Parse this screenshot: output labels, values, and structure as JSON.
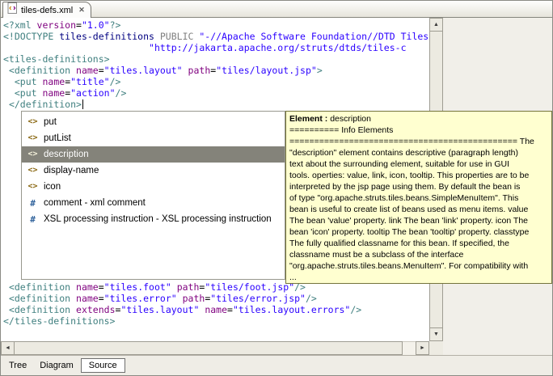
{
  "colors": {
    "syntax_tag": "#3F7F7F",
    "syntax_attr": "#7F007F",
    "syntax_value": "#2A00FF",
    "syntax_doctype_name": "#000080",
    "syntax_keyword": "#808080",
    "selection_bg": "#84837A",
    "tooltip_bg": "#FFFFD0",
    "tooltip_border": "#74743C",
    "element_icon_color": "#8B6914",
    "comment_icon_color": "#31639C"
  },
  "icons": {
    "element": "<>",
    "comment": "#",
    "close": "✕",
    "up": "▲",
    "down": "▼",
    "left": "◄",
    "right": "►"
  },
  "tab": {
    "title": "tiles-defs.xml"
  },
  "editor": {
    "top_lines": [
      [
        [
          "tag",
          "<?xml "
        ],
        [
          "attr",
          "version"
        ],
        [
          "text",
          "="
        ],
        [
          "val",
          "\"1.0\""
        ],
        [
          "tag",
          "?>"
        ]
      ],
      [
        [
          "tag",
          "<!DOCTYPE "
        ],
        [
          "dname",
          "tiles-definitions "
        ],
        [
          "kw",
          "PUBLIC "
        ],
        [
          "val",
          "\"-//Apache Software Foundation//DTD Tiles Conf"
        ]
      ],
      [
        [
          "text",
          "                          "
        ],
        [
          "val",
          "\"http://jakarta.apache.org/struts/dtds/tiles-c"
        ]
      ],
      [
        [
          "tag",
          "<tiles-definitions>"
        ]
      ],
      [
        [
          "text",
          " "
        ],
        [
          "tag",
          "<definition "
        ],
        [
          "attr",
          "name"
        ],
        [
          "text",
          "="
        ],
        [
          "val",
          "\"tiles.layout\""
        ],
        [
          "text",
          " "
        ],
        [
          "attr",
          "path"
        ],
        [
          "text",
          "="
        ],
        [
          "val",
          "\"tiles/layout.jsp\""
        ],
        [
          "tag",
          ">"
        ]
      ],
      [
        [
          "text",
          "  "
        ],
        [
          "tag",
          "<put "
        ],
        [
          "attr",
          "name"
        ],
        [
          "text",
          "="
        ],
        [
          "val",
          "\"title\""
        ],
        [
          "tag",
          "/>"
        ]
      ],
      [
        [
          "text",
          "  "
        ],
        [
          "tag",
          "<put "
        ],
        [
          "attr",
          "name"
        ],
        [
          "text",
          "="
        ],
        [
          "val",
          "\"action\""
        ],
        [
          "tag",
          "/>"
        ]
      ],
      [
        [
          "text",
          " "
        ],
        [
          "tag",
          "</definition>"
        ],
        [
          "cursor",
          ""
        ]
      ]
    ],
    "bottom_lines": [
      [
        [
          "text",
          " "
        ],
        [
          "tag",
          "<definition "
        ],
        [
          "attr",
          "name"
        ],
        [
          "text",
          "="
        ],
        [
          "val",
          "\"tiles.foot\""
        ],
        [
          "text",
          " "
        ],
        [
          "attr",
          "path"
        ],
        [
          "text",
          "="
        ],
        [
          "val",
          "\"tiles/foot.jsp\""
        ],
        [
          "tag",
          "/>"
        ]
      ],
      [
        [
          "text",
          " "
        ],
        [
          "tag",
          "<definition "
        ],
        [
          "attr",
          "name"
        ],
        [
          "text",
          "="
        ],
        [
          "val",
          "\"tiles.error\""
        ],
        [
          "text",
          " "
        ],
        [
          "attr",
          "path"
        ],
        [
          "text",
          "="
        ],
        [
          "val",
          "\"tiles/error.jsp\""
        ],
        [
          "tag",
          "/>"
        ]
      ],
      [
        [
          "text",
          " "
        ],
        [
          "tag",
          "<definition "
        ],
        [
          "attr",
          "extends"
        ],
        [
          "text",
          "="
        ],
        [
          "val",
          "\"tiles.layout\""
        ],
        [
          "text",
          " "
        ],
        [
          "attr",
          "name"
        ],
        [
          "text",
          "="
        ],
        [
          "val",
          "\"tiles.layout.errors\""
        ],
        [
          "tag",
          "/>"
        ]
      ],
      [
        [
          "tag",
          "</tiles-definitions>"
        ]
      ]
    ]
  },
  "completion": {
    "items": [
      {
        "icon": "element",
        "label": "put",
        "selected": false
      },
      {
        "icon": "element",
        "label": "putList",
        "selected": false
      },
      {
        "icon": "element",
        "label": "description",
        "selected": true
      },
      {
        "icon": "element",
        "label": "display-name",
        "selected": false
      },
      {
        "icon": "element",
        "label": "icon",
        "selected": false
      },
      {
        "icon": "comment",
        "label": "comment - xml comment",
        "selected": false
      },
      {
        "icon": "comment",
        "label": "XSL processing instruction - XSL processing instruction",
        "selected": false
      }
    ]
  },
  "doc_popup": {
    "header_label": "Element :",
    "header_value": "description",
    "lines": [
      "========== Info Elements",
      "============================================== The",
      "\"description\" element contains descriptive (paragraph length)",
      "text about the surrounding element, suitable for use in GUI",
      "tools. operties: value, link, icon, tooltip. This properties are to be",
      "interpreted by the jsp page using them. By default the bean is",
      "of type \"org.apache.struts.tiles.beans.SimpleMenuItem\". This",
      "bean is useful to create list of beans used as menu items. value",
      "The bean 'value' property. link The bean 'link' property. icon The",
      "bean 'icon' property. tooltip The bean 'tooltip' property. classtype",
      "The fully qualified classname for this bean. If specified, the",
      "classname must be a subclass of the interface",
      "\"org.apache.struts.tiles.beans.MenuItem\". For compatibility with",
      "..."
    ]
  },
  "bottom_tabs": [
    {
      "label": "Tree",
      "active": false
    },
    {
      "label": "Diagram",
      "active": false
    },
    {
      "label": "Source",
      "active": true
    }
  ]
}
